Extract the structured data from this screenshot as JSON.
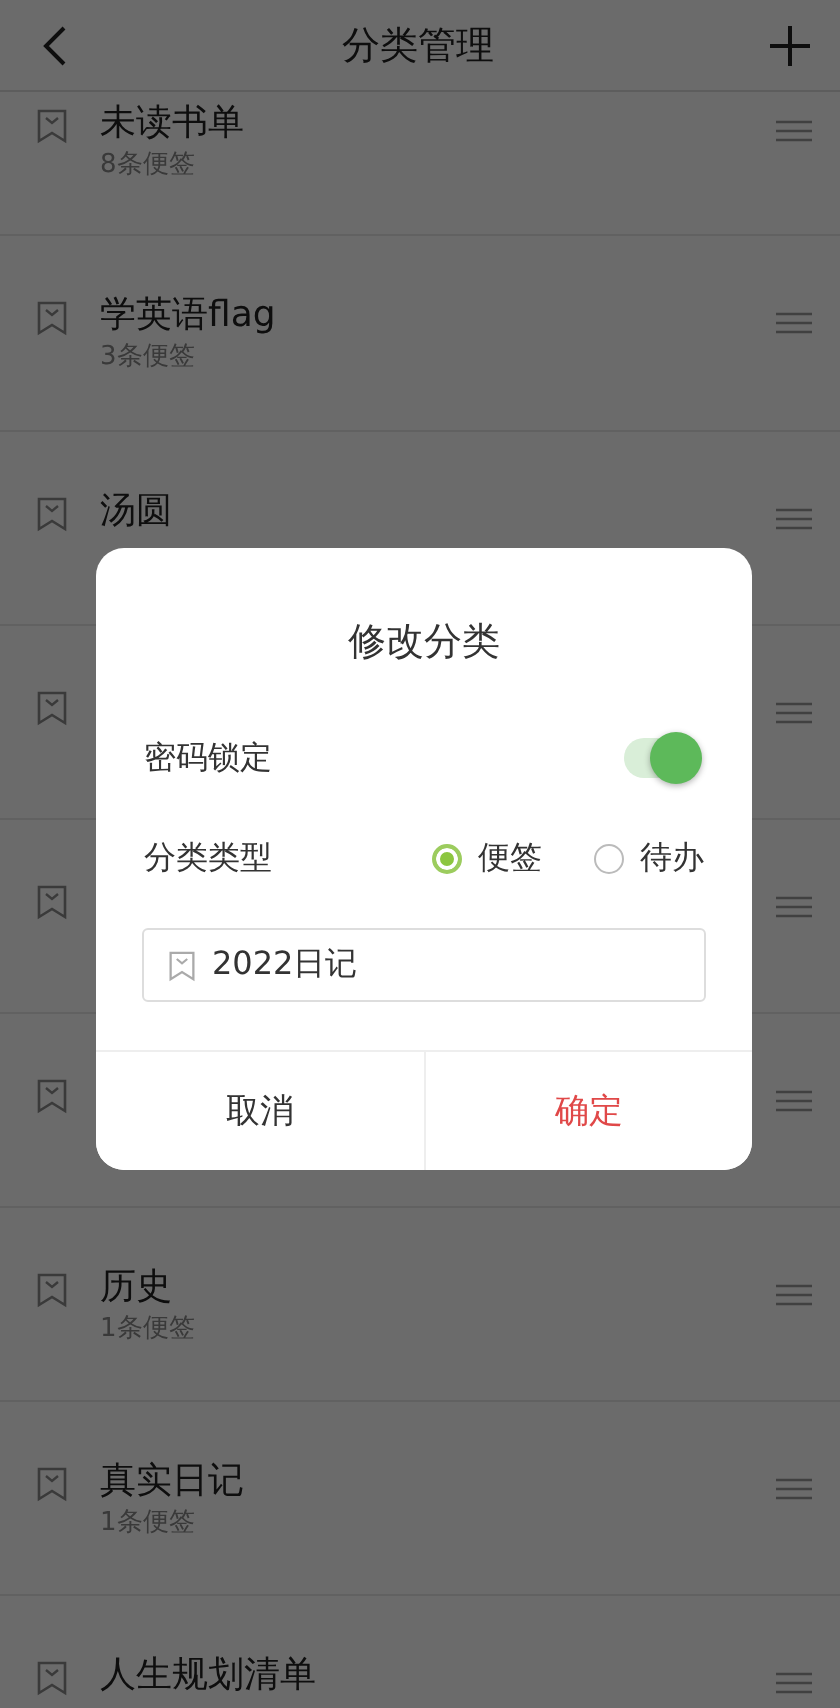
{
  "header": {
    "title": "分类管理"
  },
  "categories": [
    {
      "kind": "category",
      "title": "未读书单",
      "count": "8条便签"
    },
    {
      "kind": "category",
      "title": "学英语flag",
      "count": "3条便签"
    },
    {
      "kind": "category",
      "title": "汤圆"
    },
    {
      "kind": "covered"
    },
    {
      "kind": "covered"
    },
    {
      "kind": "covered"
    },
    {
      "kind": "category",
      "title": "历史",
      "count": "1条便签"
    },
    {
      "kind": "category",
      "title": "真实日记",
      "count": "1条便签"
    },
    {
      "kind": "category",
      "title": "人生规划清单"
    }
  ],
  "dialog": {
    "title": "修改分类",
    "lock": {
      "label": "密码锁定",
      "on": true
    },
    "type": {
      "label": "分类类型",
      "options": [
        {
          "label": "便签",
          "selected": true
        },
        {
          "label": "待办",
          "selected": false
        }
      ]
    },
    "name_field": {
      "value": "2022日记"
    },
    "buttons": [
      {
        "label": "取消",
        "kind": "cancel"
      },
      {
        "label": "确定",
        "kind": "confirm"
      }
    ]
  }
}
